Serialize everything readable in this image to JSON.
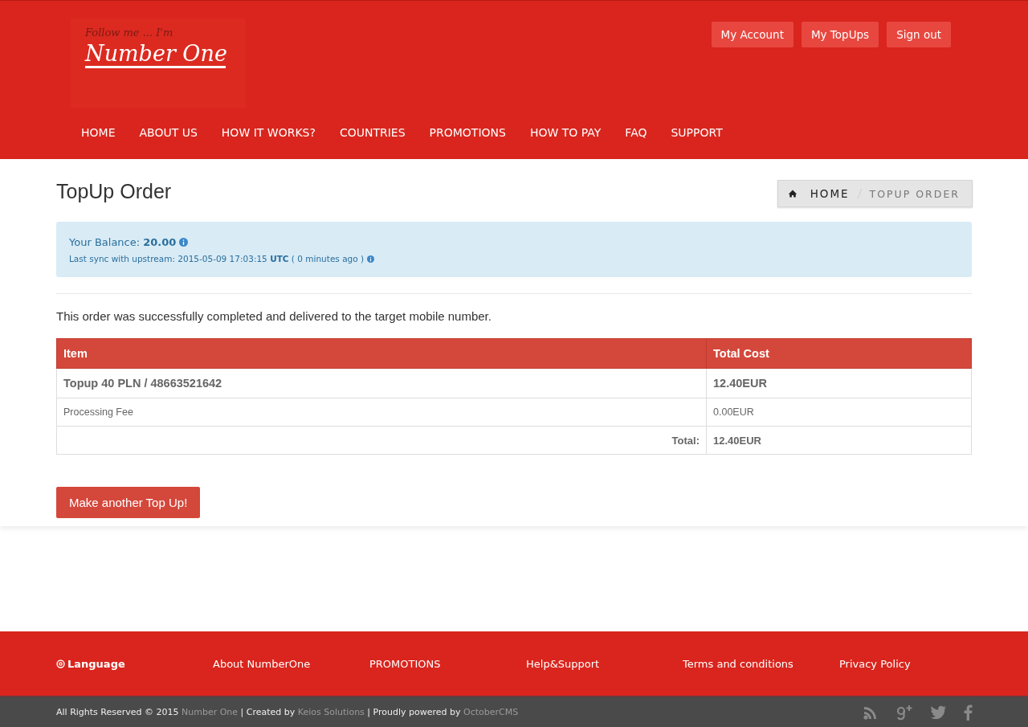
{
  "logo": {
    "tagline": "Follow me ... I'm",
    "name": "Number One"
  },
  "account_links": [
    "My Account",
    "My TopUps",
    "Sign out"
  ],
  "nav": [
    {
      "label": "HOME"
    },
    {
      "label": "ABOUT US"
    },
    {
      "label": "HOW IT WORKS?"
    },
    {
      "label": "COUNTRIES"
    },
    {
      "label": "PROMOTIONS"
    },
    {
      "label": "HOW TO PAY"
    },
    {
      "label": "FAQ"
    },
    {
      "label": "SUPPORT"
    }
  ],
  "page_title": "TopUp Order",
  "breadcrumb": [
    "HOME",
    "TOPUP ORDER"
  ],
  "balance": {
    "text": "Your Balance: **20.00**",
    "sync": "Last sync with upstream: 2015-05-09 17:03:15 **UTC** ( 0 minutes ago )"
  },
  "message": "This order was successfully completed and delivered to the target mobile number.",
  "table": {
    "columns": [
      "Item",
      "Total Cost"
    ],
    "rows": [
      {
        "kind": "main",
        "item": "Topup 40 PLN / 48663521642",
        "cost": "12.40EUR"
      },
      {
        "kind": "fee",
        "item": "Processing Fee",
        "cost": "0.00EUR"
      },
      {
        "kind": "total",
        "item": "Total:",
        "cost": "12.40EUR"
      }
    ]
  },
  "action_button": "Make another Top Up!",
  "footer_links": [
    "Language",
    "About NumberOne",
    "PROMOTIONS",
    "Help&Support",
    "Terms and conditions",
    "Privacy Policy"
  ],
  "copyright": [
    {
      "kind": "text",
      "text": "All Rights Reserved © 2015"
    },
    {
      "kind": "link",
      "text": "Number One"
    },
    {
      "kind": "text",
      "text": "| Created by"
    },
    {
      "kind": "link",
      "text": "Keios Solutions"
    },
    {
      "kind": "text",
      "text": "| Proudly powered by"
    },
    {
      "kind": "link",
      "text": "OctoberCMS"
    }
  ]
}
